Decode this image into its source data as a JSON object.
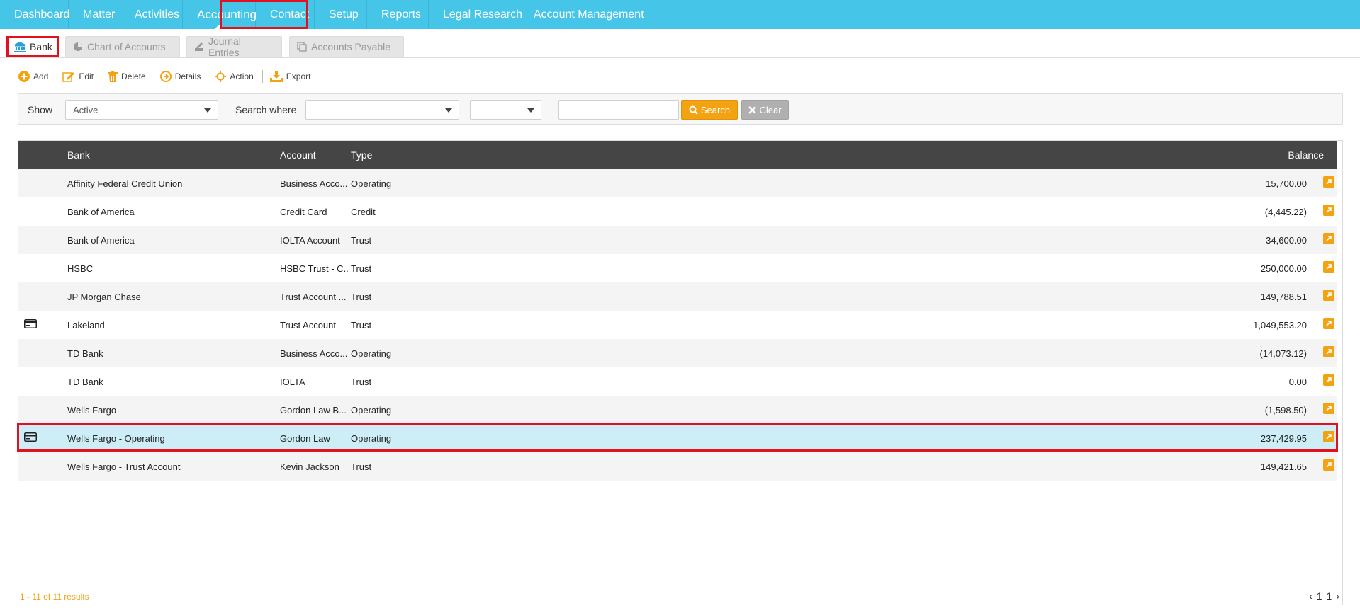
{
  "nav": {
    "items": [
      {
        "label": "Dashboard"
      },
      {
        "label": "Matter"
      },
      {
        "label": "Activities"
      },
      {
        "label": "Accounting"
      },
      {
        "label": "Contact"
      },
      {
        "label": "Setup"
      },
      {
        "label": "Reports"
      },
      {
        "label": "Legal Research"
      },
      {
        "label": "Account Management"
      }
    ],
    "active": "Accounting"
  },
  "subtabs": [
    {
      "label": "Bank",
      "icon": "bank-icon",
      "active": true
    },
    {
      "label": "Chart of Accounts",
      "icon": "pie-chart-icon",
      "active": false
    },
    {
      "label": "Journal Entries",
      "icon": "journal-icon",
      "active": false
    },
    {
      "label": "Accounts Payable",
      "icon": "copy-icon",
      "active": false
    }
  ],
  "toolbar": {
    "add": "Add",
    "edit": "Edit",
    "delete": "Delete",
    "details": "Details",
    "action": "Action",
    "export": "Export"
  },
  "filter": {
    "show_label": "Show",
    "show_value": "Active",
    "search_where_label": "Search where",
    "search_where_value": "",
    "operator_value": "",
    "search_text": "",
    "search_button": "Search",
    "clear_button": "Clear"
  },
  "grid": {
    "columns": {
      "bank": "Bank",
      "account": "Account",
      "type": "Type",
      "balance": "Balance"
    },
    "rows": [
      {
        "bank": "Affinity Federal Credit Union",
        "account": "Business Acco...",
        "type": "Operating",
        "balance": "15,700.00",
        "card": false
      },
      {
        "bank": "Bank of America",
        "account": "Credit Card",
        "type": "Credit",
        "balance": "(4,445.22)",
        "card": false
      },
      {
        "bank": "Bank of America",
        "account": "IOLTA Account",
        "type": "Trust",
        "balance": "34,600.00",
        "card": false
      },
      {
        "bank": "HSBC",
        "account": "HSBC Trust - C...",
        "type": "Trust",
        "balance": "250,000.00",
        "card": false
      },
      {
        "bank": "JP Morgan Chase",
        "account": "Trust Account ...",
        "type": "Trust",
        "balance": "149,788.51",
        "card": false
      },
      {
        "bank": "Lakeland",
        "account": "Trust Account",
        "type": "Trust",
        "balance": "1,049,553.20",
        "card": true
      },
      {
        "bank": "TD Bank",
        "account": "Business Acco...",
        "type": "Operating",
        "balance": "(14,073.12)",
        "card": false
      },
      {
        "bank": "TD Bank",
        "account": "IOLTA",
        "type": "Trust",
        "balance": "0.00",
        "card": false
      },
      {
        "bank": "Wells Fargo",
        "account": "Gordon Law B...",
        "type": "Operating",
        "balance": "(1,598.50)",
        "card": false
      },
      {
        "bank": "Wells Fargo - Operating",
        "account": "Gordon Law",
        "type": "Operating",
        "balance": "237,429.95",
        "card": true,
        "selected": true
      },
      {
        "bank": "Wells Fargo - Trust Account",
        "account": "Kevin Jackson",
        "type": "Trust",
        "balance": "149,421.65",
        "card": false
      }
    ],
    "results_text": "1 - 11 of 11 results",
    "page_prev": "‹",
    "page_first": "1",
    "page_current": "1",
    "page_next": "›"
  },
  "colors": {
    "nav_bg": "#45c6e8",
    "accent": "#f3a312",
    "header_bg": "#454545",
    "selected_row": "#cdeef7",
    "highlight_box": "#e3101e"
  }
}
